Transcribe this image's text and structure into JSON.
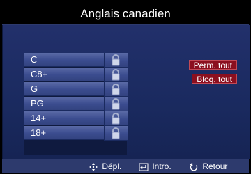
{
  "title": "Anglais canadien",
  "ratings": [
    {
      "label": "C",
      "locked": true
    },
    {
      "label": "C8+",
      "locked": true
    },
    {
      "label": "G",
      "locked": true
    },
    {
      "label": "PG",
      "locked": true
    },
    {
      "label": "14+",
      "locked": true
    },
    {
      "label": "18+",
      "locked": true
    }
  ],
  "buttons": {
    "allow_all": "Perm. tout",
    "block_all": "Bloq. tout"
  },
  "footer": {
    "move": "Dépl.",
    "enter": "Intro.",
    "back": "Retour"
  },
  "colors": {
    "panel_bg": "#22306b",
    "row_bg": "#4a5b9b",
    "button_red": "#8b0f1f",
    "footer_bg": "#2d3a6d"
  }
}
